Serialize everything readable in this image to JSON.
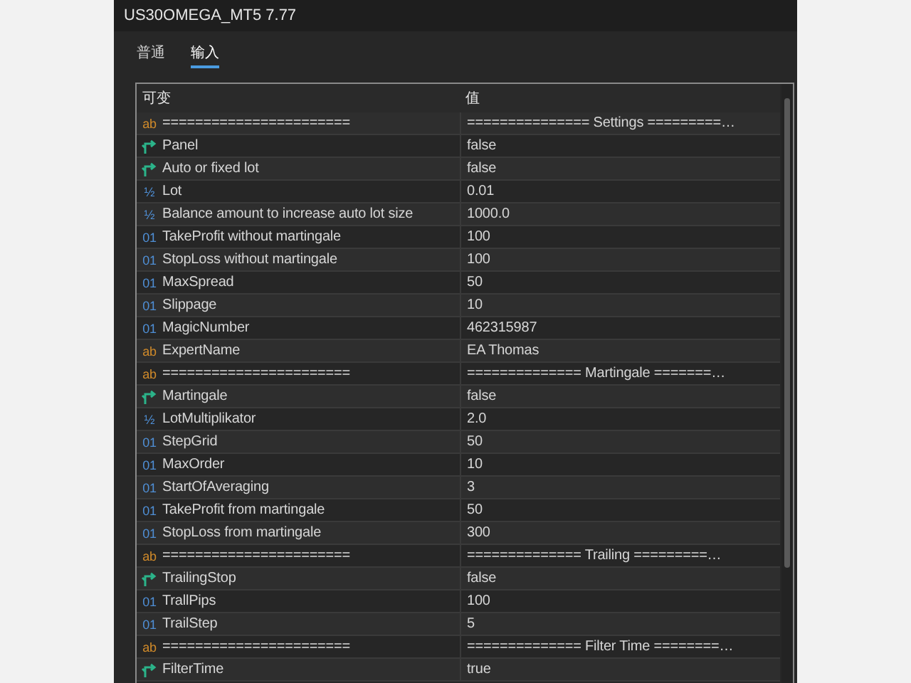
{
  "window": {
    "title": "US30OMEGA_MT5 7.77"
  },
  "tabs": [
    {
      "label": "普通",
      "selected": false
    },
    {
      "label": "输入",
      "selected": true
    }
  ],
  "table": {
    "columns": [
      "可变",
      "值"
    ],
    "rows": [
      {
        "kind": "string",
        "icon": "ab",
        "name": "=======================",
        "value": "=============== Settings =========…"
      },
      {
        "kind": "bool",
        "name": "Panel",
        "value": "false"
      },
      {
        "kind": "bool",
        "name": "Auto or fixed lot",
        "value": "false"
      },
      {
        "kind": "double",
        "icon": "½",
        "name": "Lot",
        "value": "0.01"
      },
      {
        "kind": "double",
        "icon": "½",
        "name": "Balance amount to increase auto lot size",
        "value": "1000.0"
      },
      {
        "kind": "int",
        "icon": "01",
        "name": "TakeProfit without martingale",
        "value": "100"
      },
      {
        "kind": "int",
        "icon": "01",
        "name": "StopLoss without martingale",
        "value": "100"
      },
      {
        "kind": "int",
        "icon": "01",
        "name": "MaxSpread",
        "value": "50"
      },
      {
        "kind": "int",
        "icon": "01",
        "name": "Slippage",
        "value": "10"
      },
      {
        "kind": "int",
        "icon": "01",
        "name": "MagicNumber",
        "value": "462315987"
      },
      {
        "kind": "string",
        "icon": "ab",
        "name": "ExpertName",
        "value": "EA Thomas"
      },
      {
        "kind": "string",
        "icon": "ab",
        "name": "=======================",
        "value": "============== Martingale =======…"
      },
      {
        "kind": "bool",
        "name": "Martingale",
        "value": "false"
      },
      {
        "kind": "double",
        "icon": "½",
        "name": "LotMultiplikator",
        "value": "2.0"
      },
      {
        "kind": "int",
        "icon": "01",
        "name": "StepGrid",
        "value": "50"
      },
      {
        "kind": "int",
        "icon": "01",
        "name": "MaxOrder",
        "value": "10"
      },
      {
        "kind": "int",
        "icon": "01",
        "name": "StartOfAveraging",
        "value": "3"
      },
      {
        "kind": "int",
        "icon": "01",
        "name": "TakeProfit from martingale",
        "value": "50"
      },
      {
        "kind": "int",
        "icon": "01",
        "name": "StopLoss from martingale",
        "value": "300"
      },
      {
        "kind": "string",
        "icon": "ab",
        "name": "=======================",
        "value": "============== Trailing =========…"
      },
      {
        "kind": "bool",
        "name": "TrailingStop",
        "value": "false"
      },
      {
        "kind": "int",
        "icon": "01",
        "name": "TrallPips",
        "value": "100"
      },
      {
        "kind": "int",
        "icon": "01",
        "name": "TrailStep",
        "value": "5"
      },
      {
        "kind": "string",
        "icon": "ab",
        "name": "=======================",
        "value": "============== Filter Time ========…"
      },
      {
        "kind": "bool",
        "name": "FilterTime",
        "value": "true"
      }
    ]
  }
}
